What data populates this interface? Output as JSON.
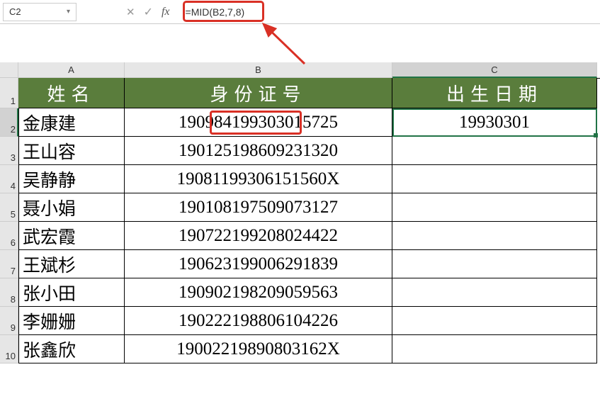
{
  "formula_bar": {
    "namebox_value": "C2",
    "formula": "=MID(B2,7,8)"
  },
  "columns": {
    "A": "A",
    "B": "B",
    "C": "C"
  },
  "header_row": {
    "A": "姓名",
    "B": "身份证号",
    "C": "出生日期"
  },
  "rows": [
    {
      "A": "金康建",
      "B": "190984199303015725",
      "C": "19930301"
    },
    {
      "A": "王山容",
      "B": "190125198609231320",
      "C": ""
    },
    {
      "A": "吴静静",
      "B": "19081199306151560X",
      "C": ""
    },
    {
      "A": "聂小娟",
      "B": "190108197509073127",
      "C": ""
    },
    {
      "A": "武宏霞",
      "B": "190722199208024422",
      "C": ""
    },
    {
      "A": "王斌杉",
      "B": "190623199006291839",
      "C": ""
    },
    {
      "A": "张小田",
      "B": "190902198209059563",
      "C": ""
    },
    {
      "A": "李姗姗",
      "B": "190222198806104226",
      "C": ""
    },
    {
      "A": "张鑫欣",
      "B": "19002219890803162X",
      "C": ""
    }
  ],
  "active_cell": "C2",
  "row_labels": [
    "1",
    "2",
    "3",
    "4",
    "5",
    "6",
    "7",
    "8",
    "9",
    "10"
  ],
  "icons": {
    "cancel": "✕",
    "confirm": "✓",
    "fx": "fx",
    "dropdown": "▾"
  },
  "chart_data": {
    "type": "table",
    "title": "",
    "columns": [
      "姓名",
      "身份证号",
      "出生日期"
    ],
    "data": [
      [
        "金康建",
        "190984199303015725",
        "19930301"
      ],
      [
        "王山容",
        "190125198609231320",
        ""
      ],
      [
        "吴静静",
        "19081199306151560X",
        ""
      ],
      [
        "聂小娟",
        "190108197509073127",
        ""
      ],
      [
        "武宏霞",
        "190722199208024422",
        ""
      ],
      [
        "王斌杉",
        "190623199006291839",
        ""
      ],
      [
        "张小田",
        "190902198209059563",
        ""
      ],
      [
        "李姗姗",
        "190222198806104226",
        ""
      ],
      [
        "张鑫欣",
        "19002219890803162X",
        ""
      ]
    ]
  }
}
